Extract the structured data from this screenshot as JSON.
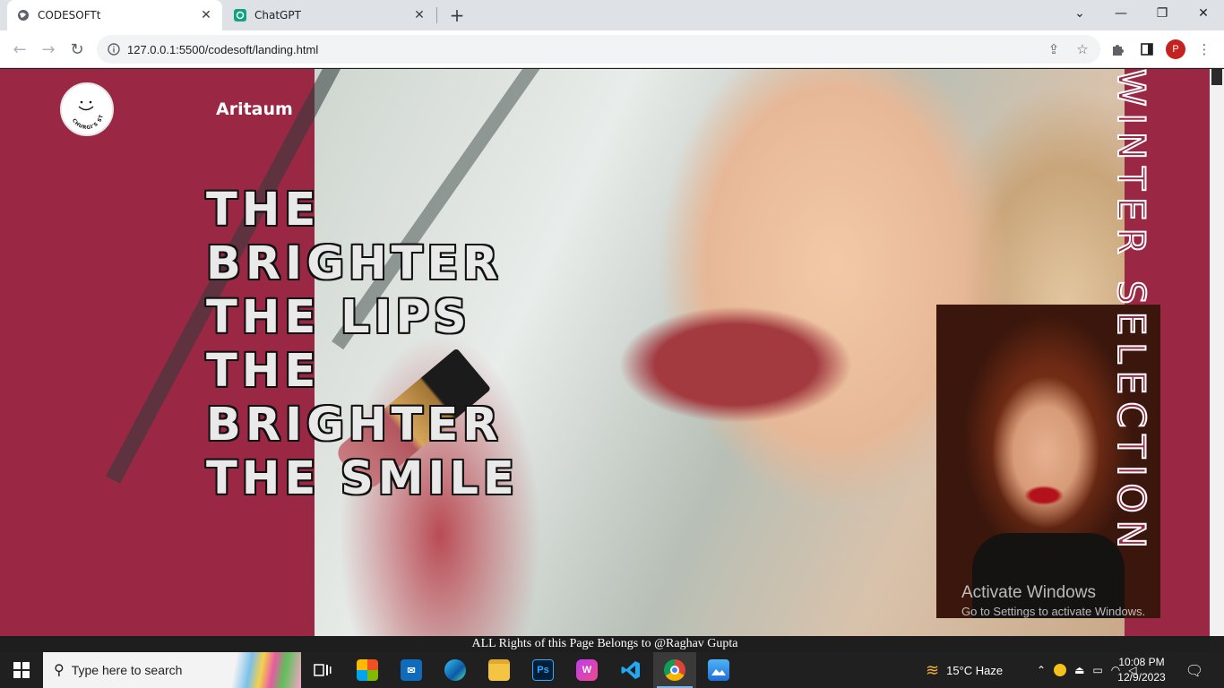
{
  "browser": {
    "tabs": [
      {
        "title": "CODESOFTt",
        "favicon": "globe-icon",
        "active": true
      },
      {
        "title": "ChatGPT",
        "favicon": "chatgpt-icon",
        "active": false
      }
    ],
    "url": "127.0.0.1:5500/codesoft/landing.html",
    "profile_initial": "P"
  },
  "page": {
    "logo_text": "CHURGI'S STUDIO",
    "brand": "Aritaum",
    "headline": [
      "THE",
      "BRIGHTER",
      "THE LIPS",
      "THE",
      "BRIGHTER",
      "THE SMILE"
    ],
    "side_text": "WINTER SELECTION",
    "footer": "ALL Rights of this Page Belongs to @Raghav Gupta",
    "background_color": "#9a2845"
  },
  "watermark": {
    "title": "Activate Windows",
    "subtitle": "Go to Settings to activate Windows."
  },
  "taskbar": {
    "search_placeholder": "Type here to search",
    "weather": "15°C  Haze",
    "time": "10:08 PM",
    "date": "12/9/2023",
    "apps": [
      "task-view",
      "microsoft-store",
      "mail",
      "edge",
      "file-explorer",
      "photoshop",
      "wps-office",
      "vscode",
      "chrome",
      "photos"
    ]
  }
}
